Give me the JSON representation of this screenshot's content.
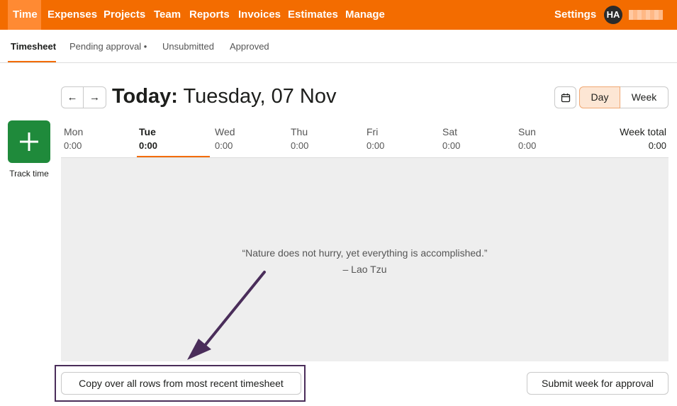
{
  "topnav": {
    "items": [
      "Time",
      "Expenses",
      "Projects",
      "Team",
      "Reports",
      "Invoices",
      "Estimates",
      "Manage"
    ],
    "settings": "Settings",
    "avatar_initials": "HA",
    "brand_color": "#f36c00"
  },
  "subnav": {
    "tabs": [
      "Timesheet",
      "Pending approval •",
      "Unsubmitted",
      "Approved"
    ]
  },
  "header": {
    "prev_icon": "←",
    "next_icon": "→",
    "title_prefix": "Today:",
    "title_date": "Tuesday, 07 Nov",
    "calendar_icon": "calendar-icon",
    "view_day": "Day",
    "view_week": "Week"
  },
  "track": {
    "label": "Track time",
    "color": "#1f8a3b"
  },
  "days": [
    {
      "name": "Mon",
      "time": "0:00"
    },
    {
      "name": "Tue",
      "time": "0:00"
    },
    {
      "name": "Wed",
      "time": "0:00"
    },
    {
      "name": "Thu",
      "time": "0:00"
    },
    {
      "name": "Fri",
      "time": "0:00"
    },
    {
      "name": "Sat",
      "time": "0:00"
    },
    {
      "name": "Sun",
      "time": "0:00"
    }
  ],
  "week_total": {
    "label": "Week total",
    "time": "0:00"
  },
  "empty_state": {
    "quote": "“Nature does not hurry, yet everything is accomplished.”",
    "author": "– Lao Tzu"
  },
  "footer": {
    "copy_label": "Copy over all rows from most recent timesheet",
    "submit_label": "Submit week for approval"
  }
}
